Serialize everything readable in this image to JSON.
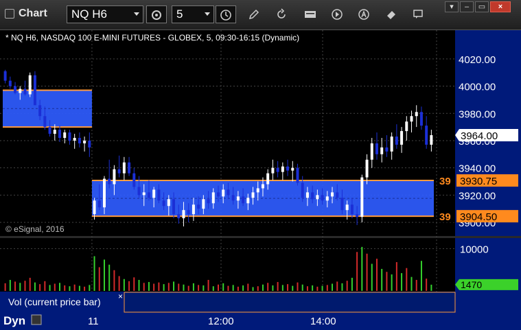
{
  "window": {
    "title": "Chart",
    "symbol": "NQ H6",
    "interval": "5",
    "watermark": "© eSignal, 2016"
  },
  "toolbar": {
    "icons": [
      "clock-settings-icon",
      "clock-icon",
      "pencil-icon",
      "refresh-icon",
      "study-icon",
      "play-icon",
      "alert-icon",
      "eraser-icon",
      "comment-icon"
    ]
  },
  "chart_header": "* NQ H6, NASDAQ 100 E-MINI FUTURES - GLOBEX, 5, 09:30-16:15 (Dynamic)",
  "price_axis": {
    "ticks": [
      "4020.00",
      "4000.00",
      "3980.00",
      "3960.00",
      "3940.00",
      "3920.00",
      "3900.00"
    ],
    "current_price": "3964.00",
    "zone_high_label": "3930.75",
    "zone_low_label": "3904.50",
    "zone_short_label": "39"
  },
  "volume_axis": {
    "tick": "10000",
    "current_volume": "1470"
  },
  "volume_panel": {
    "label": "Vol (current price bar)",
    "close": "×"
  },
  "time_axis": {
    "prefix": "Dyn",
    "ticks": [
      "11",
      "12:00",
      "14:00"
    ]
  },
  "colors": {
    "background": "#000000",
    "axis_bg": "#001a7a",
    "zone_fill": "#2f5cff",
    "zone_border": "#ff9a3c",
    "candle_up": "#ffffff",
    "candle_down": "#1b2fd6",
    "vol_up": "#35d12d",
    "vol_down": "#d42a2a",
    "current_price_bg": "#ffffff",
    "current_vol_bg": "#3bd12a",
    "zone_label_bg": "#ff8a1e"
  },
  "chart_data": {
    "type": "candlestick",
    "ylim": [
      3895,
      4030
    ],
    "zones": [
      {
        "x_start": 0,
        "x_end": 18,
        "low": 3970,
        "high": 3997
      },
      {
        "x_start": 18,
        "x_end": 95,
        "low": 3904.5,
        "high": 3930.75
      }
    ],
    "candles": [
      [
        4011,
        4012,
        4002,
        4004
      ],
      [
        4004,
        4007,
        3998,
        4000
      ],
      [
        4000,
        4003,
        3994,
        3995
      ],
      [
        3995,
        4000,
        3990,
        3998
      ],
      [
        3998,
        4004,
        3993,
        3994
      ],
      [
        3994,
        4010,
        3992,
        4008
      ],
      [
        4008,
        4011,
        3990,
        3986
      ],
      [
        3986,
        3990,
        3975,
        3978
      ],
      [
        3978,
        3985,
        3968,
        3970
      ],
      [
        3970,
        3975,
        3963,
        3965
      ],
      [
        3965,
        3972,
        3960,
        3968
      ],
      [
        3968,
        3971,
        3959,
        3962
      ],
      [
        3962,
        3968,
        3958,
        3966
      ],
      [
        3966,
        3968,
        3957,
        3960
      ],
      [
        3960,
        3965,
        3954,
        3962
      ],
      [
        3962,
        3966,
        3955,
        3958
      ],
      [
        3958,
        3963,
        3952,
        3960
      ],
      [
        3960,
        3966,
        3948,
        3955
      ],
      [
        3906,
        3918,
        3902,
        3916
      ],
      [
        3916,
        3928,
        3909,
        3911
      ],
      [
        3911,
        3934,
        3906,
        3932
      ],
      [
        3932,
        3946,
        3925,
        3928
      ],
      [
        3928,
        3942,
        3920,
        3939
      ],
      [
        3939,
        3949,
        3933,
        3936
      ],
      [
        3936,
        3948,
        3931,
        3944
      ],
      [
        3944,
        3948,
        3934,
        3936
      ],
      [
        3936,
        3940,
        3924,
        3926
      ],
      [
        3926,
        3934,
        3918,
        3920
      ],
      [
        3920,
        3928,
        3912,
        3922
      ],
      [
        3922,
        3931,
        3916,
        3918
      ],
      [
        3918,
        3926,
        3911,
        3924
      ],
      [
        3924,
        3928,
        3914,
        3916
      ],
      [
        3916,
        3922,
        3909,
        3912
      ],
      [
        3912,
        3920,
        3905,
        3917
      ],
      [
        3917,
        3922,
        3903,
        3906
      ],
      [
        3906,
        3913,
        3899,
        3903
      ],
      [
        3903,
        3915,
        3897,
        3909
      ],
      [
        3909,
        3914,
        3900,
        3906
      ],
      [
        3906,
        3918,
        3901,
        3913
      ],
      [
        3913,
        3919,
        3906,
        3910
      ],
      [
        3910,
        3920,
        3906,
        3917
      ],
      [
        3917,
        3923,
        3910,
        3914
      ],
      [
        3914,
        3925,
        3910,
        3922
      ],
      [
        3922,
        3927,
        3915,
        3919
      ],
      [
        3919,
        3928,
        3914,
        3924
      ],
      [
        3924,
        3929,
        3917,
        3920
      ],
      [
        3920,
        3926,
        3913,
        3916
      ],
      [
        3916,
        3923,
        3910,
        3919
      ],
      [
        3919,
        3925,
        3912,
        3914
      ],
      [
        3914,
        3921,
        3909,
        3918
      ],
      [
        3918,
        3926,
        3913,
        3922
      ],
      [
        3922,
        3930,
        3916,
        3925
      ],
      [
        3925,
        3933,
        3919,
        3928
      ],
      [
        3928,
        3939,
        3924,
        3936
      ],
      [
        3936,
        3946,
        3931,
        3940
      ],
      [
        3940,
        3945,
        3933,
        3937
      ],
      [
        3937,
        3944,
        3931,
        3941
      ],
      [
        3941,
        3946,
        3934,
        3938
      ],
      [
        3938,
        3945,
        3930,
        3940
      ],
      [
        3940,
        3943,
        3927,
        3929
      ],
      [
        3929,
        3934,
        3915,
        3918
      ],
      [
        3918,
        3926,
        3912,
        3922
      ],
      [
        3922,
        3927,
        3914,
        3917
      ],
      [
        3917,
        3924,
        3912,
        3920
      ],
      [
        3920,
        3925,
        3913,
        3916
      ],
      [
        3916,
        3923,
        3911,
        3919
      ],
      [
        3919,
        3926,
        3914,
        3922
      ],
      [
        3922,
        3928,
        3916,
        3918
      ],
      [
        3918,
        3924,
        3906,
        3909
      ],
      [
        3909,
        3916,
        3902,
        3913
      ],
      [
        3913,
        3918,
        3903,
        3906
      ],
      [
        3906,
        3912,
        3898,
        3904
      ],
      [
        3904,
        3935,
        3900,
        3933
      ],
      [
        3933,
        3950,
        3928,
        3946
      ],
      [
        3946,
        3962,
        3940,
        3958
      ],
      [
        3958,
        3966,
        3946,
        3950
      ],
      [
        3950,
        3962,
        3944,
        3955
      ],
      [
        3955,
        3964,
        3948,
        3952
      ],
      [
        3952,
        3966,
        3946,
        3963
      ],
      [
        3963,
        3972,
        3954,
        3957
      ],
      [
        3957,
        3970,
        3951,
        3967
      ],
      [
        3967,
        3978,
        3960,
        3974
      ],
      [
        3974,
        3982,
        3966,
        3978
      ],
      [
        3978,
        3986,
        3970,
        3981
      ],
      [
        3981,
        3985,
        3968,
        3971
      ],
      [
        3971,
        3978,
        3954,
        3957
      ],
      [
        3957,
        3968,
        3952,
        3964
      ]
    ],
    "volume": [
      {
        "v": 1800,
        "up": false
      },
      {
        "v": 2600,
        "up": true
      },
      {
        "v": 2200,
        "up": false
      },
      {
        "v": 1900,
        "up": true
      },
      {
        "v": 2400,
        "up": false
      },
      {
        "v": 3100,
        "up": false
      },
      {
        "v": 2000,
        "up": true
      },
      {
        "v": 1600,
        "up": false
      },
      {
        "v": 2300,
        "up": false
      },
      {
        "v": 1400,
        "up": true
      },
      {
        "v": 1700,
        "up": false
      },
      {
        "v": 1900,
        "up": true
      },
      {
        "v": 1300,
        "up": false
      },
      {
        "v": 1100,
        "up": true
      },
      {
        "v": 1500,
        "up": false
      },
      {
        "v": 1200,
        "up": true
      },
      {
        "v": 1000,
        "up": false
      },
      {
        "v": 1400,
        "up": true
      },
      {
        "v": 8200,
        "up": true
      },
      {
        "v": 5600,
        "up": false
      },
      {
        "v": 7400,
        "up": true
      },
      {
        "v": 6200,
        "up": true
      },
      {
        "v": 4900,
        "up": false
      },
      {
        "v": 3500,
        "up": false
      },
      {
        "v": 2800,
        "up": true
      },
      {
        "v": 2300,
        "up": false
      },
      {
        "v": 3200,
        "up": false
      },
      {
        "v": 2600,
        "up": true
      },
      {
        "v": 1900,
        "up": false
      },
      {
        "v": 2100,
        "up": true
      },
      {
        "v": 1700,
        "up": false
      },
      {
        "v": 2000,
        "up": false
      },
      {
        "v": 1600,
        "up": true
      },
      {
        "v": 1900,
        "up": false
      },
      {
        "v": 2200,
        "up": true
      },
      {
        "v": 1700,
        "up": false
      },
      {
        "v": 1500,
        "up": true
      },
      {
        "v": 1200,
        "up": false
      },
      {
        "v": 1800,
        "up": true
      },
      {
        "v": 1400,
        "up": false
      },
      {
        "v": 1300,
        "up": true
      },
      {
        "v": 2600,
        "up": false
      },
      {
        "v": 1100,
        "up": true
      },
      {
        "v": 1500,
        "up": false
      },
      {
        "v": 1800,
        "up": true
      },
      {
        "v": 1200,
        "up": false
      },
      {
        "v": 1400,
        "up": true
      },
      {
        "v": 1000,
        "up": false
      },
      {
        "v": 1300,
        "up": true
      },
      {
        "v": 1700,
        "up": false
      },
      {
        "v": 900,
        "up": true
      },
      {
        "v": 1100,
        "up": false
      },
      {
        "v": 1500,
        "up": true
      },
      {
        "v": 1900,
        "up": false
      },
      {
        "v": 1300,
        "up": true
      },
      {
        "v": 2100,
        "up": false
      },
      {
        "v": 1400,
        "up": true
      },
      {
        "v": 1600,
        "up": false
      },
      {
        "v": 1200,
        "up": true
      },
      {
        "v": 2000,
        "up": false
      },
      {
        "v": 1500,
        "up": true
      },
      {
        "v": 1100,
        "up": false
      },
      {
        "v": 1300,
        "up": true
      },
      {
        "v": 1000,
        "up": false
      },
      {
        "v": 1200,
        "up": true
      },
      {
        "v": 1400,
        "up": false
      },
      {
        "v": 1700,
        "up": true
      },
      {
        "v": 2200,
        "up": false
      },
      {
        "v": 1800,
        "up": true
      },
      {
        "v": 2400,
        "up": false
      },
      {
        "v": 3100,
        "up": true
      },
      {
        "v": 9200,
        "up": false
      },
      {
        "v": 10400,
        "up": true
      },
      {
        "v": 8800,
        "up": false
      },
      {
        "v": 6400,
        "up": true
      },
      {
        "v": 7600,
        "up": false
      },
      {
        "v": 5200,
        "up": true
      },
      {
        "v": 4500,
        "up": false
      },
      {
        "v": 3900,
        "up": true
      },
      {
        "v": 6800,
        "up": false
      },
      {
        "v": 4200,
        "up": true
      },
      {
        "v": 5400,
        "up": false
      },
      {
        "v": 3300,
        "up": true
      },
      {
        "v": 2600,
        "up": false
      },
      {
        "v": 7100,
        "up": true
      },
      {
        "v": 2900,
        "up": false
      },
      {
        "v": 1470,
        "up": true
      }
    ],
    "volume_ylim": [
      0,
      12000
    ]
  }
}
